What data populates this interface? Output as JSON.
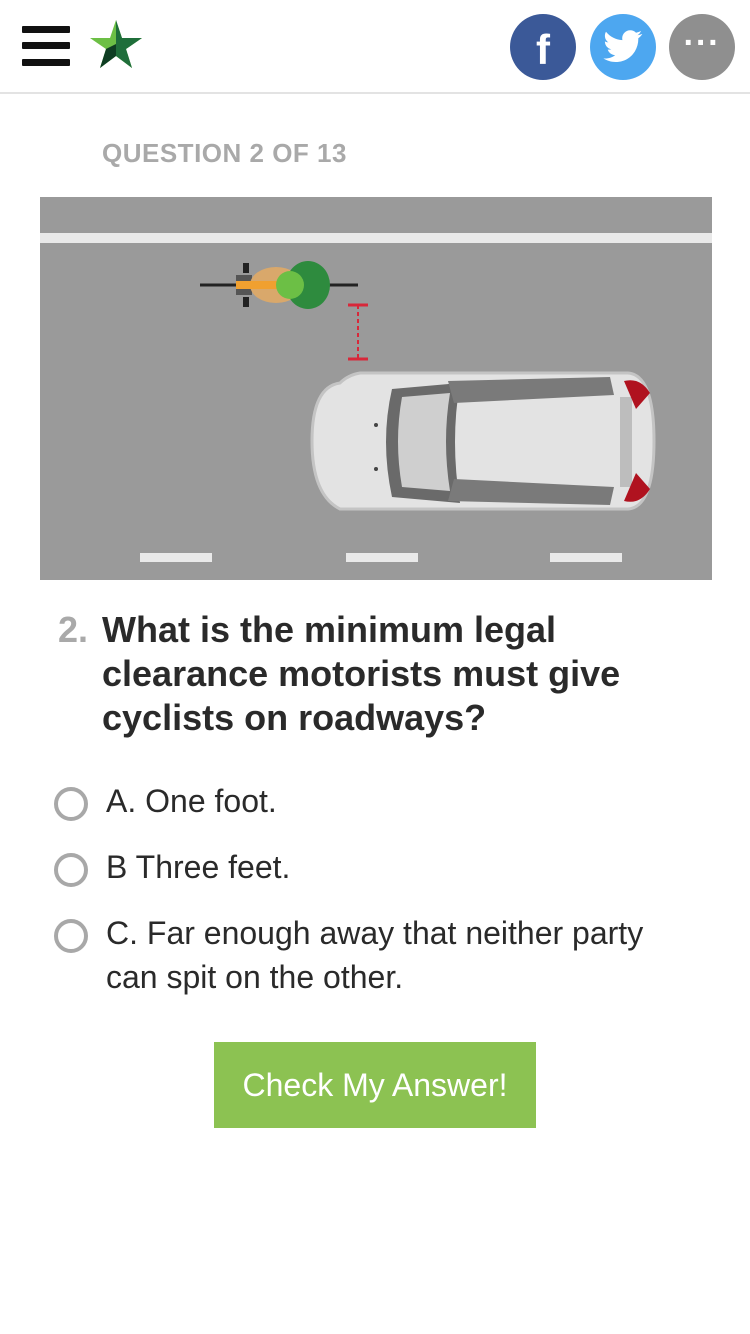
{
  "header": {
    "menu_icon": "hamburger-menu-icon",
    "logo_icon": "star-logo-icon",
    "logo_colors": {
      "green": "#1f6e3a",
      "light_green": "#6cbf45",
      "dark": "#0e3d22"
    },
    "share_buttons": [
      {
        "name": "facebook",
        "icon": "facebook-icon",
        "glyph": "f",
        "color": "#3b5998"
      },
      {
        "name": "twitter",
        "icon": "twitter-bird-icon",
        "color": "#4da7f0"
      },
      {
        "name": "more",
        "icon": "more-dots-icon",
        "glyph": "···",
        "color": "#8f8f8f"
      }
    ]
  },
  "quiz": {
    "progress_label": "QUESTION 2 OF 13",
    "question_number": "2.",
    "question_text": "What is the minimum legal clearance motorists must give cyclists on roadways?",
    "options": [
      {
        "label": "A. One foot.",
        "selected": false
      },
      {
        "label": "B Three feet.",
        "selected": false
      },
      {
        "label": "C. Far enough away that neither party can spit on the other.",
        "selected": false
      }
    ],
    "submit_label": "Check My Answer!",
    "submit_color": "#8cc252"
  },
  "illustration": {
    "icon": "road-car-cyclist-illustration",
    "road_color": "#9a9a9a",
    "clearance_marker_color": "#d8283a"
  }
}
